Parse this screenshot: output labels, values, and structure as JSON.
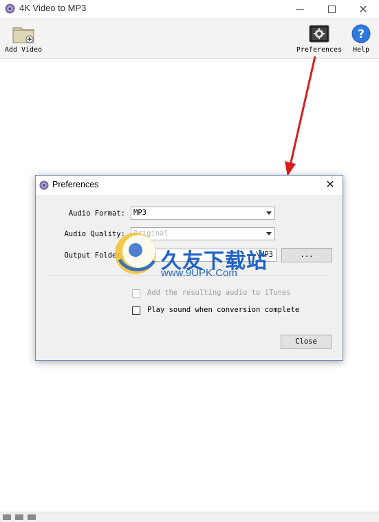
{
  "window": {
    "title": "4K Video to MP3"
  },
  "toolbar": {
    "add_video_label": "Add Video",
    "preferences_label": "Preferences",
    "help_label": "Help"
  },
  "dialog": {
    "title": "Preferences",
    "audio_format_label": "Audio Format:",
    "audio_format_value": "MP3",
    "audio_quality_label": "Audio Quality:",
    "audio_quality_value": "Original",
    "output_folder_label": "Output Folder:",
    "output_folder_value": "...\\MP3",
    "browse_label": "...",
    "itunes_label": "Add the resulting audio to iTunes",
    "play_sound_label": "Play sound when conversion complete",
    "close_label": "Close"
  },
  "watermark": {
    "text_cn": "久友下载站",
    "text_en": "www.9UPK.Com"
  },
  "colors": {
    "accent": "#1f62c8",
    "arrow": "#d91d1d",
    "dialog_border": "#6b8fb8"
  }
}
